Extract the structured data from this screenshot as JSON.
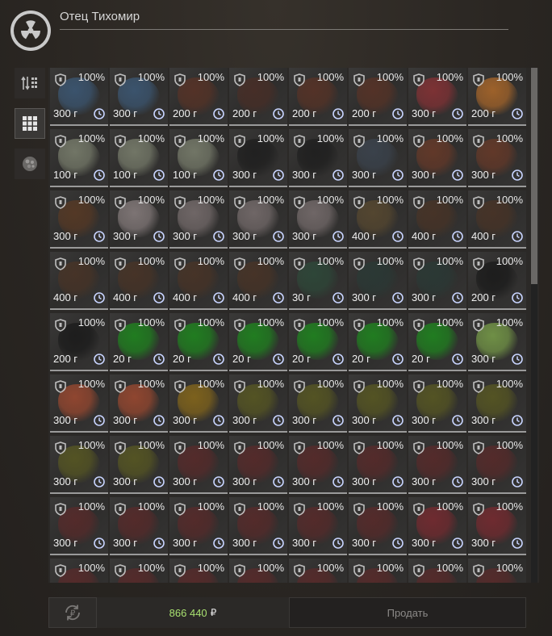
{
  "header": {
    "trader_name": "Отец Тихомир",
    "logo_icon": "radiation-icon"
  },
  "sidebar": [
    {
      "icon": "sort-icon",
      "active": false
    },
    {
      "icon": "grid-view-icon",
      "active": true
    },
    {
      "icon": "artifact-filter-icon",
      "active": false
    }
  ],
  "items": [
    {
      "durability": "100%",
      "weight": "300 г",
      "color": "#3d5a78"
    },
    {
      "durability": "100%",
      "weight": "300 г",
      "color": "#3d5a78"
    },
    {
      "durability": "100%",
      "weight": "200 г",
      "color": "#5a3326"
    },
    {
      "durability": "100%",
      "weight": "200 г",
      "color": "#4a2e26"
    },
    {
      "durability": "100%",
      "weight": "200 г",
      "color": "#5a3326"
    },
    {
      "durability": "100%",
      "weight": "200 г",
      "color": "#5a3326"
    },
    {
      "durability": "100%",
      "weight": "300 г",
      "color": "#8a3236"
    },
    {
      "durability": "100%",
      "weight": "200 г",
      "color": "#b06a2a"
    },
    {
      "durability": "100%",
      "weight": "100 г",
      "color": "#7d8270"
    },
    {
      "durability": "100%",
      "weight": "100 г",
      "color": "#7d8270"
    },
    {
      "durability": "100%",
      "weight": "100 г",
      "color": "#7d8270"
    },
    {
      "durability": "100%",
      "weight": "300 г",
      "color": "#1e1e1e"
    },
    {
      "durability": "100%",
      "weight": "300 г",
      "color": "#1e1e1e"
    },
    {
      "durability": "100%",
      "weight": "300 г",
      "color": "#3c4550"
    },
    {
      "durability": "100%",
      "weight": "300 г",
      "color": "#6a3a28"
    },
    {
      "durability": "100%",
      "weight": "300 г",
      "color": "#6a3a28"
    },
    {
      "durability": "100%",
      "weight": "300 г",
      "color": "#5a3a24"
    },
    {
      "durability": "100%",
      "weight": "300 г",
      "color": "#8a8080"
    },
    {
      "durability": "100%",
      "weight": "300 г",
      "color": "#7a7070"
    },
    {
      "durability": "100%",
      "weight": "300 г",
      "color": "#7a7070"
    },
    {
      "durability": "100%",
      "weight": "300 г",
      "color": "#7a7070"
    },
    {
      "durability": "100%",
      "weight": "400 г",
      "color": "#5a4a30"
    },
    {
      "durability": "100%",
      "weight": "400 г",
      "color": "#4a3426"
    },
    {
      "durability": "100%",
      "weight": "400 г",
      "color": "#4a3426"
    },
    {
      "durability": "100%",
      "weight": "400 г",
      "color": "#4a3426"
    },
    {
      "durability": "100%",
      "weight": "400 г",
      "color": "#4a3426"
    },
    {
      "durability": "100%",
      "weight": "400 г",
      "color": "#4a3426"
    },
    {
      "durability": "100%",
      "weight": "400 г",
      "color": "#4a3426"
    },
    {
      "durability": "100%",
      "weight": "30 г",
      "color": "#2e4a3a"
    },
    {
      "durability": "100%",
      "weight": "300 г",
      "color": "#2a3a36"
    },
    {
      "durability": "100%",
      "weight": "300 г",
      "color": "#2a3a36"
    },
    {
      "durability": "100%",
      "weight": "200 г",
      "color": "#1a1a1a"
    },
    {
      "durability": "100%",
      "weight": "200 г",
      "color": "#1a1a1a"
    },
    {
      "durability": "100%",
      "weight": "20 г",
      "color": "#1e8a1e"
    },
    {
      "durability": "100%",
      "weight": "20 г",
      "color": "#1e8a1e"
    },
    {
      "durability": "100%",
      "weight": "20 г",
      "color": "#1e8a1e"
    },
    {
      "durability": "100%",
      "weight": "20 г",
      "color": "#1e8a1e"
    },
    {
      "durability": "100%",
      "weight": "20 г",
      "color": "#1e8a1e"
    },
    {
      "durability": "100%",
      "weight": "20 г",
      "color": "#1e8a1e"
    },
    {
      "durability": "100%",
      "weight": "300 г",
      "color": "#7aa04a"
    },
    {
      "durability": "100%",
      "weight": "300 г",
      "color": "#a04a30"
    },
    {
      "durability": "100%",
      "weight": "300 г",
      "color": "#a04a30"
    },
    {
      "durability": "100%",
      "weight": "300 г",
      "color": "#8a6a1a"
    },
    {
      "durability": "100%",
      "weight": "300 г",
      "color": "#5a5a22"
    },
    {
      "durability": "100%",
      "weight": "300 г",
      "color": "#5a5a22"
    },
    {
      "durability": "100%",
      "weight": "300 г",
      "color": "#5a5a22"
    },
    {
      "durability": "100%",
      "weight": "300 г",
      "color": "#5a5a22"
    },
    {
      "durability": "100%",
      "weight": "300 г",
      "color": "#5a5a22"
    },
    {
      "durability": "100%",
      "weight": "300 г",
      "color": "#5a5a22"
    },
    {
      "durability": "100%",
      "weight": "300 г",
      "color": "#5a5a22"
    },
    {
      "durability": "100%",
      "weight": "300 г",
      "color": "#5a2a2a"
    },
    {
      "durability": "100%",
      "weight": "300 г",
      "color": "#5a2a2a"
    },
    {
      "durability": "100%",
      "weight": "300 г",
      "color": "#5a2a2a"
    },
    {
      "durability": "100%",
      "weight": "300 г",
      "color": "#5a2a2a"
    },
    {
      "durability": "100%",
      "weight": "300 г",
      "color": "#5a2a2a"
    },
    {
      "durability": "100%",
      "weight": "300 г",
      "color": "#5a2a2a"
    },
    {
      "durability": "100%",
      "weight": "300 г",
      "color": "#5a2a2a"
    },
    {
      "durability": "100%",
      "weight": "300 г",
      "color": "#5a2a2a"
    },
    {
      "durability": "100%",
      "weight": "300 г",
      "color": "#5a2a2a"
    },
    {
      "durability": "100%",
      "weight": "300 г",
      "color": "#5a2a2a"
    },
    {
      "durability": "100%",
      "weight": "300 г",
      "color": "#5a2a2a"
    },
    {
      "durability": "100%",
      "weight": "300 г",
      "color": "#5a2a2a"
    },
    {
      "durability": "100%",
      "weight": "300 г",
      "color": "#7a2a30"
    },
    {
      "durability": "100%",
      "weight": "300 г",
      "color": "#7a2a30"
    },
    {
      "durability": "100%",
      "weight": "",
      "color": "#5a2a2a"
    },
    {
      "durability": "100%",
      "weight": "",
      "color": "#5a2a2a"
    },
    {
      "durability": "100%",
      "weight": "",
      "color": "#5a2a2a"
    },
    {
      "durability": "100%",
      "weight": "",
      "color": "#5a2a2a"
    },
    {
      "durability": "100%",
      "weight": "",
      "color": "#5a2a2a"
    },
    {
      "durability": "100%",
      "weight": "",
      "color": "#5a2a2a"
    },
    {
      "durability": "100%",
      "weight": "",
      "color": "#5a2a2a"
    },
    {
      "durability": "100%",
      "weight": "",
      "color": "#5a2a2a"
    }
  ],
  "footer": {
    "cycle_icon": "currency-cycle-icon",
    "money_amount": "866 440",
    "currency": "₽",
    "sell_label": "Продать"
  },
  "colors": {
    "money": "#a8e070",
    "cell_border": "#9a9a9a"
  }
}
